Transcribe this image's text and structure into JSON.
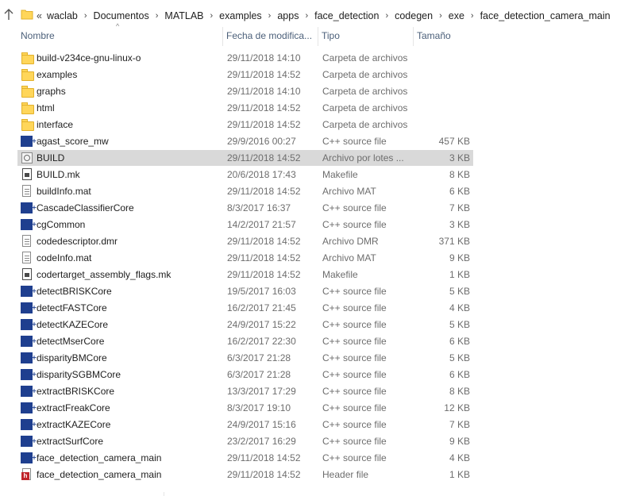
{
  "address_bar": {
    "overflow": "«",
    "crumbs": [
      "waclab",
      "Documentos",
      "MATLAB",
      "examples",
      "apps",
      "face_detection",
      "codegen",
      "exe",
      "face_detection_camera_main"
    ]
  },
  "columns": {
    "name": "Nombre",
    "date": "Fecha de modifica...",
    "type": "Tipo",
    "size": "Tamaño",
    "sort_indicator": "^"
  },
  "files": [
    {
      "name": "build-v234ce-gnu-linux-o",
      "date": "29/11/2018 14:10",
      "type": "Carpeta de archivos",
      "size": "",
      "icon": "folder-icon"
    },
    {
      "name": "examples",
      "date": "29/11/2018 14:52",
      "type": "Carpeta de archivos",
      "size": "",
      "icon": "folder-icon"
    },
    {
      "name": "graphs",
      "date": "29/11/2018 14:10",
      "type": "Carpeta de archivos",
      "size": "",
      "icon": "folder-icon"
    },
    {
      "name": "html",
      "date": "29/11/2018 14:52",
      "type": "Carpeta de archivos",
      "size": "",
      "icon": "folder-icon"
    },
    {
      "name": "interface",
      "date": "29/11/2018 14:52",
      "type": "Carpeta de archivos",
      "size": "",
      "icon": "folder-icon"
    },
    {
      "name": "agast_score_mw",
      "date": "29/9/2016 00:27",
      "type": "C++ source file",
      "size": "457 KB",
      "icon": "cpp-file-icon"
    },
    {
      "name": "BUILD",
      "date": "29/11/2018 14:52",
      "type": "Archivo por lotes ...",
      "size": "3 KB",
      "icon": "batch-file-icon",
      "selected": true
    },
    {
      "name": "BUILD.mk",
      "date": "20/6/2018 17:43",
      "type": "Makefile",
      "size": "8 KB",
      "icon": "makefile-icon"
    },
    {
      "name": "buildInfo.mat",
      "date": "29/11/2018 14:52",
      "type": "Archivo MAT",
      "size": "6 KB",
      "icon": "document-icon"
    },
    {
      "name": "CascadeClassifierCore",
      "date": "8/3/2017 16:37",
      "type": "C++ source file",
      "size": "7 KB",
      "icon": "cpp-file-icon"
    },
    {
      "name": "cgCommon",
      "date": "14/2/2017 21:57",
      "type": "C++ source file",
      "size": "3 KB",
      "icon": "cpp-file-icon"
    },
    {
      "name": "codedescriptor.dmr",
      "date": "29/11/2018 14:52",
      "type": "Archivo DMR",
      "size": "371 KB",
      "icon": "document-icon"
    },
    {
      "name": "codeInfo.mat",
      "date": "29/11/2018 14:52",
      "type": "Archivo MAT",
      "size": "9 KB",
      "icon": "document-icon"
    },
    {
      "name": "codertarget_assembly_flags.mk",
      "date": "29/11/2018 14:52",
      "type": "Makefile",
      "size": "1 KB",
      "icon": "makefile-icon"
    },
    {
      "name": "detectBRISKCore",
      "date": "19/5/2017 16:03",
      "type": "C++ source file",
      "size": "5 KB",
      "icon": "cpp-file-icon"
    },
    {
      "name": "detectFASTCore",
      "date": "16/2/2017 21:45",
      "type": "C++ source file",
      "size": "4 KB",
      "icon": "cpp-file-icon"
    },
    {
      "name": "detectKAZECore",
      "date": "24/9/2017 15:22",
      "type": "C++ source file",
      "size": "5 KB",
      "icon": "cpp-file-icon"
    },
    {
      "name": "detectMserCore",
      "date": "16/2/2017 22:30",
      "type": "C++ source file",
      "size": "6 KB",
      "icon": "cpp-file-icon"
    },
    {
      "name": "disparityBMCore",
      "date": "6/3/2017 21:28",
      "type": "C++ source file",
      "size": "5 KB",
      "icon": "cpp-file-icon"
    },
    {
      "name": "disparitySGBMCore",
      "date": "6/3/2017 21:28",
      "type": "C++ source file",
      "size": "6 KB",
      "icon": "cpp-file-icon"
    },
    {
      "name": "extractBRISKCore",
      "date": "13/3/2017 17:29",
      "type": "C++ source file",
      "size": "8 KB",
      "icon": "cpp-file-icon"
    },
    {
      "name": "extractFreakCore",
      "date": "8/3/2017 19:10",
      "type": "C++ source file",
      "size": "12 KB",
      "icon": "cpp-file-icon"
    },
    {
      "name": "extractKAZECore",
      "date": "24/9/2017 15:16",
      "type": "C++ source file",
      "size": "7 KB",
      "icon": "cpp-file-icon"
    },
    {
      "name": "extractSurfCore",
      "date": "23/2/2017 16:29",
      "type": "C++ source file",
      "size": "9 KB",
      "icon": "cpp-file-icon"
    },
    {
      "name": "face_detection_camera_main",
      "date": "29/11/2018 14:52",
      "type": "C++ source file",
      "size": "4 KB",
      "icon": "cpp-file-icon"
    },
    {
      "name": "face_detection_camera_main",
      "date": "29/11/2018 14:52",
      "type": "Header file",
      "size": "1 KB",
      "icon": "header-file-icon"
    }
  ],
  "colors": {
    "selected_row": "#d9d9d9",
    "header_text": "#4c607a",
    "folder": "#ffd65a",
    "cpp_icon": "#1f3f8f",
    "header_icon": "#c0242a"
  }
}
